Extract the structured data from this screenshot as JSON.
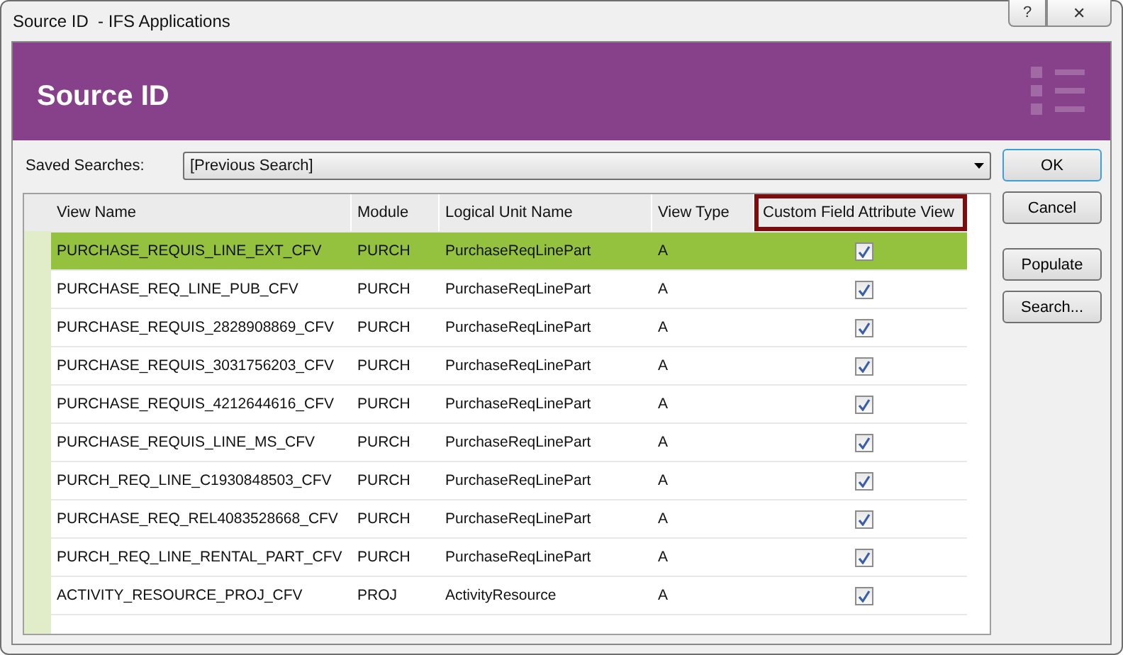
{
  "window": {
    "title": "Source ID  - IFS Applications",
    "buttons": [
      {
        "kind": "help",
        "label": "?"
      },
      {
        "kind": "close",
        "label": "✕"
      }
    ]
  },
  "header": {
    "title": "Source ID"
  },
  "saved_searches": {
    "label": "Saved Searches:",
    "value": "[Previous Search]"
  },
  "table": {
    "columns": [
      {
        "label": "View Name",
        "highlighted": false
      },
      {
        "label": "Module",
        "highlighted": false
      },
      {
        "label": "Logical Unit Name",
        "highlighted": false
      },
      {
        "label": "View Type",
        "highlighted": false
      },
      {
        "label": "Custom Field Attribute View",
        "highlighted": true
      }
    ],
    "rows": [
      {
        "view_name": "PURCHASE_REQUIS_LINE_EXT_CFV",
        "module": "PURCH",
        "logical_unit": "PurchaseReqLinePart",
        "view_type": "A",
        "custom": true,
        "selected": true
      },
      {
        "view_name": "PURCHASE_REQ_LINE_PUB_CFV",
        "module": "PURCH",
        "logical_unit": "PurchaseReqLinePart",
        "view_type": "A",
        "custom": true,
        "selected": false
      },
      {
        "view_name": "PURCHASE_REQUIS_2828908869_CFV",
        "module": "PURCH",
        "logical_unit": "PurchaseReqLinePart",
        "view_type": "A",
        "custom": true,
        "selected": false
      },
      {
        "view_name": "PURCHASE_REQUIS_3031756203_CFV",
        "module": "PURCH",
        "logical_unit": "PurchaseReqLinePart",
        "view_type": "A",
        "custom": true,
        "selected": false
      },
      {
        "view_name": "PURCHASE_REQUIS_4212644616_CFV",
        "module": "PURCH",
        "logical_unit": "PurchaseReqLinePart",
        "view_type": "A",
        "custom": true,
        "selected": false
      },
      {
        "view_name": "PURCHASE_REQUIS_LINE_MS_CFV",
        "module": "PURCH",
        "logical_unit": "PurchaseReqLinePart",
        "view_type": "A",
        "custom": true,
        "selected": false
      },
      {
        "view_name": "PURCH_REQ_LINE_C1930848503_CFV",
        "module": "PURCH",
        "logical_unit": "PurchaseReqLinePart",
        "view_type": "A",
        "custom": true,
        "selected": false
      },
      {
        "view_name": "PURCHASE_REQ_REL4083528668_CFV",
        "module": "PURCH",
        "logical_unit": "PurchaseReqLinePart",
        "view_type": "A",
        "custom": true,
        "selected": false
      },
      {
        "view_name": "PURCH_REQ_LINE_RENTAL_PART_CFV",
        "module": "PURCH",
        "logical_unit": "PurchaseReqLinePart",
        "view_type": "A",
        "custom": true,
        "selected": false
      },
      {
        "view_name": "ACTIVITY_RESOURCE_PROJ_CFV",
        "module": "PROJ",
        "logical_unit": "ActivityResource",
        "view_type": "A",
        "custom": true,
        "selected": false
      }
    ]
  },
  "buttons": [
    {
      "label": "OK",
      "default": true
    },
    {
      "label": "Cancel",
      "default": false
    },
    {
      "label": "Populate",
      "default": false
    },
    {
      "label": "Search...",
      "default": false
    }
  ]
}
